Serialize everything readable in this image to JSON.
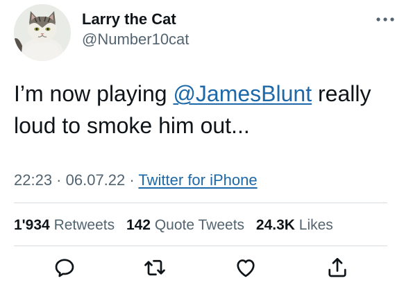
{
  "author": {
    "display_name": "Larry the Cat",
    "handle": "@Number10cat",
    "avatar_icon": "cat-avatar"
  },
  "tweet": {
    "text_before": "I’m now playing ",
    "mention": "@JamesBlunt",
    "text_after": " really loud to smoke him out..."
  },
  "meta": {
    "time": "22:23",
    "separator": " · ",
    "date": "06.07.22",
    "source": "Twitter for iPhone"
  },
  "stats": {
    "retweets_count": "1'934",
    "retweets_label": "Retweets",
    "quote_count": "142",
    "quote_label": "Quote Tweets",
    "likes_count": "24.3K",
    "likes_label": "Likes"
  },
  "actions": {
    "reply_icon": "reply-icon",
    "retweet_icon": "retweet-icon",
    "like_icon": "like-icon",
    "share_icon": "share-icon",
    "more_icon": "more-icon"
  },
  "colors": {
    "text": "#0f1419",
    "secondary": "#536471",
    "link": "#1d68a8",
    "divider": "#d8dde1"
  }
}
